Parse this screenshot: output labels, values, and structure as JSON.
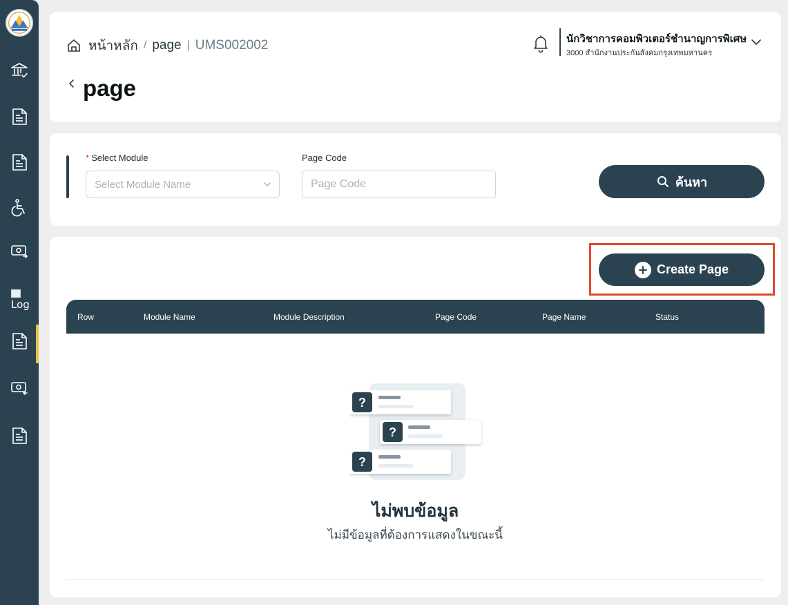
{
  "sidebar": {
    "items": [
      {
        "icon": "bank-check-icon"
      },
      {
        "icon": "document-icon"
      },
      {
        "icon": "document-icon"
      },
      {
        "icon": "wheelchair-icon"
      },
      {
        "icon": "money-transfer-icon"
      },
      {
        "icon": "broken-image-icon",
        "alt": "Log"
      },
      {
        "icon": "document-icon",
        "active": true
      },
      {
        "icon": "money-transfer-icon"
      },
      {
        "icon": "document-icon"
      }
    ],
    "active_color": "#e2c44a",
    "bg_color": "#2b4350"
  },
  "breadcrumb": {
    "home": "หน้าหลัก",
    "sep1": "/",
    "page": "page",
    "sep2": "|",
    "code": "UMS002002"
  },
  "header": {
    "title": "page"
  },
  "user": {
    "name": "นักวิชาการคอมพิวเตอร์ชำนาญการพิเศษ",
    "org": "3000 สำนักงานประกันสังคมกรุงเทพมหานคร"
  },
  "search": {
    "module_label": "Select Module",
    "module_required": "*",
    "module_placeholder": "Select Module Name",
    "page_code_label": "Page Code",
    "page_code_placeholder": "Page Code",
    "search_button": "ค้นหา"
  },
  "actions": {
    "create_button": "Create Page"
  },
  "table": {
    "columns": [
      "Row",
      "Module Name",
      "Module Description",
      "Page Code",
      "Page Name",
      "Status"
    ],
    "rows": []
  },
  "empty_state": {
    "title": "ไม่พบข้อมูล",
    "subtitle": "ไม่มีข้อมูลที่ต้องการแสดงในขณะนี้"
  },
  "colors": {
    "primary": "#2b4350",
    "highlight": "#e0492a",
    "required": "#d9362b"
  }
}
